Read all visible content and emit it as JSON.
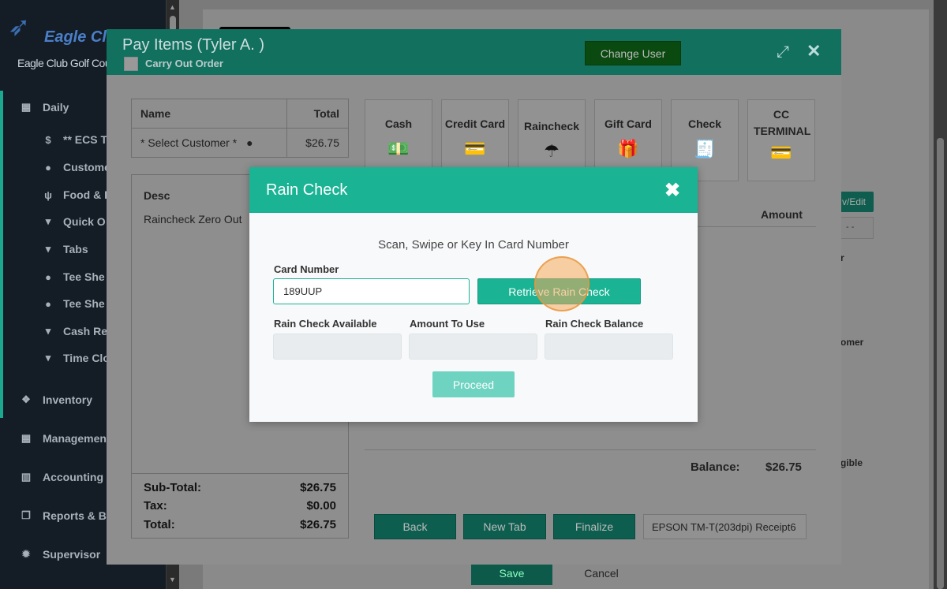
{
  "sidebar": {
    "logo_text": "Eagle Club",
    "club_name": "Eagle Club Golf Cours",
    "items": [
      {
        "label": "Daily",
        "icon": "calendar-icon"
      },
      {
        "label": "** ECS T",
        "icon": "dollar-icon"
      },
      {
        "label": "Custome",
        "icon": "user-icon"
      },
      {
        "label": "Food & B",
        "icon": "utensils-icon"
      },
      {
        "label": "Quick O",
        "icon": "cart-icon"
      },
      {
        "label": "Tabs",
        "icon": "cart-icon"
      },
      {
        "label": "Tee She",
        "icon": "golf-ball-icon"
      },
      {
        "label": "Tee She",
        "icon": "golf-ball-icon"
      },
      {
        "label": "Cash Re",
        "icon": "cart-icon"
      },
      {
        "label": "Time Clo",
        "icon": "cart-icon"
      },
      {
        "label": "Inventory",
        "icon": "cubes-icon"
      },
      {
        "label": "Managemen",
        "icon": "grid-icon"
      },
      {
        "label": "Accounting",
        "icon": "bar-chart-icon"
      },
      {
        "label": "Reports & Bi",
        "icon": "copy-icon"
      },
      {
        "label": "Supervisor",
        "icon": "gear-icon"
      }
    ]
  },
  "background_page": {
    "save_label": "Save",
    "cancel_label": "Cancel",
    "edit_button_fragment": "v/Edit",
    "select_fragment": "- -",
    "text_fragments": [
      "r",
      "omer",
      "gible"
    ]
  },
  "pay_items": {
    "title": "Pay Items (Tyler A. )",
    "carry_out_label": "Carry Out Order",
    "change_user_label": "Change User",
    "customer_table": {
      "headers": [
        "Name",
        "Total"
      ],
      "row": {
        "name": "* Select Customer *",
        "total": "$26.75"
      }
    },
    "desc_header": "Desc",
    "desc_items": [
      "Raincheck Zero Out"
    ],
    "tenders": [
      {
        "label": "Cash",
        "icon": "cash-icon"
      },
      {
        "label": "Credit Card",
        "icon": "credit-card-icon"
      },
      {
        "label": "Raincheck",
        "icon": "umbrella-icon"
      },
      {
        "label": "Gift Card",
        "icon": "gift-card-icon"
      },
      {
        "label": "Check",
        "icon": "check-icon"
      },
      {
        "label": "CC TERMINAL",
        "icon": "card-terminal-icon"
      }
    ],
    "amount_header": "Amount",
    "balance_label": "Balance:",
    "balance_value": "$26.75",
    "totals": {
      "subtotal_label": "Sub-Total:",
      "subtotal": "$26.75",
      "tax_label": "Tax:",
      "tax": "$0.00",
      "total_label": "Total:",
      "total": "$26.75"
    },
    "buttons": {
      "back": "Back",
      "new_tab": "New Tab",
      "finalize": "Finalize"
    },
    "printer": "EPSON TM-T(203dpi) Receipt6"
  },
  "rain_check": {
    "title": "Rain Check",
    "instruction": "Scan, Swipe or Key In Card Number",
    "card_number_label": "Card Number",
    "card_number_value": "189UUP",
    "retrieve_label": "Retrieve Rain Check",
    "available_label": "Rain Check Available",
    "amount_to_use_label": "Amount To Use",
    "balance_label": "Rain Check Balance",
    "available_value": "",
    "amount_to_use_value": "",
    "balance_value": "",
    "proceed_label": "Proceed"
  },
  "colors": {
    "accent": "#1ab394",
    "header_dim": "#12705f",
    "sidebar_bg": "#141c26"
  }
}
